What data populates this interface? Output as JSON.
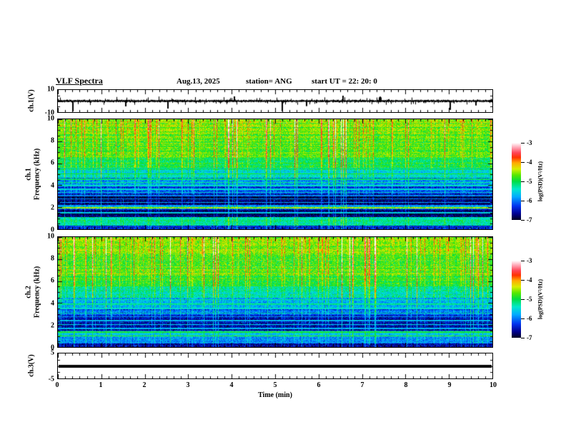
{
  "header": {
    "title": "VLF Spectra",
    "date": "Aug.13, 2025",
    "station": "station= ANG",
    "start_ut": "start UT  =   22: 20: 0"
  },
  "axes": {
    "time": {
      "label": "Time (min)",
      "min": 0,
      "max": 10,
      "major_ticks": [
        0,
        1,
        2,
        3,
        4,
        5,
        6,
        7,
        8,
        9,
        10
      ],
      "minor_per_major": 6
    },
    "freq": {
      "min": 0,
      "max": 10,
      "major_ticks": [
        10,
        8,
        6,
        4,
        2,
        0
      ],
      "minor_step_khz": 0.5
    },
    "wave_volts": {
      "min": -10,
      "max": 10,
      "tick_labels": [
        10,
        -10
      ]
    },
    "ch3_volts": {
      "min": -5,
      "max": 5,
      "tick_labels": [
        5,
        -5
      ]
    }
  },
  "labels": {
    "ch1_wave": "ch.1(V)",
    "ch1_spec_line1": "ch.1",
    "ch2_spec_line1": "ch.2",
    "freq_line2": "Frequency (kHz)",
    "ch3_wave": "ch.3(V)"
  },
  "colorbar": {
    "label": "log(PSD)(V²/Hz)",
    "ticks": [
      -3,
      -4,
      -5,
      -6,
      -7
    ],
    "min": -7,
    "max": -3,
    "colormap_stops": [
      {
        "t": 0.0,
        "c": "#000020"
      },
      {
        "t": 0.08,
        "c": "#000090"
      },
      {
        "t": 0.18,
        "c": "#0033ee"
      },
      {
        "t": 0.3,
        "c": "#00aaff"
      },
      {
        "t": 0.4,
        "c": "#00e8cc"
      },
      {
        "t": 0.5,
        "c": "#00dd44"
      },
      {
        "t": 0.58,
        "c": "#55e800"
      },
      {
        "t": 0.66,
        "c": "#d8ee00"
      },
      {
        "t": 0.74,
        "c": "#ffaa00"
      },
      {
        "t": 0.81,
        "c": "#ff3300"
      },
      {
        "t": 0.87,
        "c": "#ff4455"
      },
      {
        "t": 0.93,
        "c": "#ff99aa"
      },
      {
        "t": 1.0,
        "c": "#ffffff"
      }
    ]
  },
  "chart_data": [
    {
      "id": "ch1_waveform",
      "type": "line",
      "ylabel": "ch.1(V)",
      "xlim": [
        0,
        10
      ],
      "ylim": [
        -10,
        10
      ],
      "description": "broadband noise centered on 0 V, envelope about +/-2 V with impulsive sferic spikes",
      "noise_envelope_v": 1.6,
      "seed": 11,
      "spikes_t_v": [
        [
          0.33,
          -9.5
        ],
        [
          1.55,
          -4.8
        ],
        [
          2.52,
          -6.8
        ],
        [
          4.05,
          4.2
        ],
        [
          5.15,
          -9.2
        ],
        [
          5.7,
          -4.6
        ],
        [
          6.55,
          4.8
        ],
        [
          7.4,
          4.0
        ],
        [
          9.02,
          -8.0
        ],
        [
          9.6,
          -4.0
        ]
      ]
    },
    {
      "id": "ch1_spectrogram",
      "type": "heatmap",
      "ylabel": "ch.1 Frequency (kHz)",
      "zlabel": "log(PSD)(V²/Hz)",
      "xlim": [
        0,
        10
      ],
      "ylim": [
        0,
        10
      ],
      "zlim": [
        -7,
        -3
      ],
      "seed": 42,
      "bands_khz_psd": [
        {
          "f0": 0.0,
          "f1": 0.35,
          "psd": -6.4
        },
        {
          "f0": 0.35,
          "f1": 1.1,
          "psd": -5.3
        },
        {
          "f0": 1.1,
          "f1": 1.85,
          "psd": -6.75
        },
        {
          "f0": 1.85,
          "f1": 2.2,
          "psd": -5.9
        },
        {
          "f0": 2.2,
          "f1": 3.2,
          "psd": -6.8
        },
        {
          "f0": 3.2,
          "f1": 4.0,
          "psd": -6.3
        },
        {
          "f0": 4.0,
          "f1": 4.7,
          "psd": -5.9
        },
        {
          "f0": 4.7,
          "f1": 5.6,
          "psd": -5.4
        },
        {
          "f0": 5.6,
          "f1": 6.5,
          "psd": -5.0
        },
        {
          "f0": 6.5,
          "f1": 8.0,
          "psd": -4.75
        },
        {
          "f0": 8.0,
          "f1": 10.0,
          "psd": -4.6
        }
      ],
      "harmonic_lines": [
        {
          "f": 1.5,
          "b": 1.2
        },
        {
          "f": 1.95,
          "b": 1.4
        },
        {
          "f": 2.45,
          "b": 1.0
        },
        {
          "f": 2.75,
          "b": 0.9
        },
        {
          "f": 3.05,
          "b": 0.9
        },
        {
          "f": 3.35,
          "b": 0.8
        },
        {
          "f": 3.65,
          "b": 0.8
        },
        {
          "f": 3.95,
          "b": 0.9
        },
        {
          "f": 4.25,
          "b": 0.7
        },
        {
          "f": 4.55,
          "b": 0.8
        },
        {
          "f": 5.05,
          "b": 0.5
        },
        {
          "f": 5.5,
          "b": 0.4
        }
      ],
      "streaks": {
        "prob_strong": 0.05,
        "prob_med": 0.12,
        "strong": [
          0.9,
          1.9
        ],
        "med": [
          0.4,
          1.0
        ]
      }
    },
    {
      "id": "ch2_spectrogram",
      "type": "heatmap",
      "ylabel": "ch.2 Frequency (kHz)",
      "zlabel": "log(PSD)(V²/Hz)",
      "xlim": [
        0,
        10
      ],
      "ylim": [
        0,
        10
      ],
      "zlim": [
        -7,
        -3
      ],
      "seed": 77,
      "bands_khz_psd": [
        {
          "f0": 0.0,
          "f1": 0.3,
          "psd": -6.5
        },
        {
          "f0": 0.3,
          "f1": 0.9,
          "psd": -5.9
        },
        {
          "f0": 0.9,
          "f1": 1.5,
          "psd": -5.7
        },
        {
          "f0": 1.5,
          "f1": 2.9,
          "psd": -6.6
        },
        {
          "f0": 2.9,
          "f1": 3.6,
          "psd": -6.1
        },
        {
          "f0": 3.6,
          "f1": 4.5,
          "psd": -5.8
        },
        {
          "f0": 4.5,
          "f1": 5.5,
          "psd": -5.3
        },
        {
          "f0": 5.5,
          "f1": 6.5,
          "psd": -4.9
        },
        {
          "f0": 6.5,
          "f1": 8.5,
          "psd": -4.7
        },
        {
          "f0": 8.5,
          "f1": 10.0,
          "psd": -4.55
        }
      ],
      "harmonic_lines": [
        {
          "f": 1.0,
          "b": 0.9
        },
        {
          "f": 1.35,
          "b": 0.8
        },
        {
          "f": 1.7,
          "b": 0.9
        },
        {
          "f": 2.05,
          "b": 1.1
        },
        {
          "f": 2.4,
          "b": 0.9
        },
        {
          "f": 2.75,
          "b": 0.8
        },
        {
          "f": 3.1,
          "b": 0.8
        },
        {
          "f": 3.5,
          "b": 0.7
        },
        {
          "f": 3.9,
          "b": 0.6
        },
        {
          "f": 4.3,
          "b": 0.6
        }
      ],
      "streaks": {
        "prob_strong": 0.06,
        "prob_med": 0.13,
        "strong": [
          0.9,
          1.9
        ],
        "med": [
          0.4,
          1.0
        ]
      }
    },
    {
      "id": "ch3_waveform",
      "type": "line",
      "ylabel": "ch.3(V)",
      "xlim": [
        0,
        10
      ],
      "ylim": [
        -5,
        5
      ],
      "description": "constant flat trace at 0 V for entire record",
      "value_v": 0
    }
  ]
}
